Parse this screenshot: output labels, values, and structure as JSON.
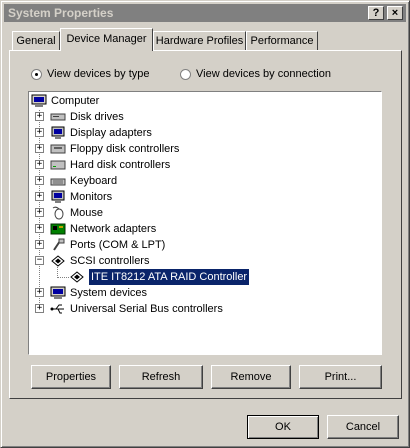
{
  "window": {
    "title": "System Properties",
    "help_label": "?",
    "close_label": "×"
  },
  "tabs": [
    {
      "label": "General"
    },
    {
      "label": "Device Manager"
    },
    {
      "label": "Hardware Profiles"
    },
    {
      "label": "Performance"
    }
  ],
  "view": {
    "by_type_label": "View devices by type",
    "by_connection_label": "View devices by connection",
    "selected": "by_type"
  },
  "tree": {
    "root": "Computer",
    "items": [
      {
        "label": "Disk drives",
        "icon": "disk-drive-icon",
        "expanded": false
      },
      {
        "label": "Display adapters",
        "icon": "monitor-icon",
        "expanded": false
      },
      {
        "label": "Floppy disk controllers",
        "icon": "floppy-controller-icon",
        "expanded": false
      },
      {
        "label": "Hard disk controllers",
        "icon": "hard-disk-controller-icon",
        "expanded": false
      },
      {
        "label": "Keyboard",
        "icon": "keyboard-icon",
        "expanded": false
      },
      {
        "label": "Monitors",
        "icon": "monitor-icon",
        "expanded": false
      },
      {
        "label": "Mouse",
        "icon": "mouse-icon",
        "expanded": false
      },
      {
        "label": "Network adapters",
        "icon": "network-adapter-icon",
        "expanded": false
      },
      {
        "label": "Ports (COM & LPT)",
        "icon": "port-icon",
        "expanded": false
      },
      {
        "label": "SCSI controllers",
        "icon": "scsi-icon",
        "expanded": true
      },
      {
        "label": "System devices",
        "icon": "computer-icon",
        "expanded": false
      },
      {
        "label": "Universal Serial Bus controllers",
        "icon": "usb-icon",
        "expanded": false
      }
    ],
    "child": {
      "label": "ITE IT8212 ATA RAID Controller",
      "icon": "scsi-icon",
      "selected": true
    }
  },
  "actions": {
    "properties_label": "Properties",
    "refresh_label": "Refresh",
    "remove_label": "Remove",
    "print_label": "Print..."
  },
  "footer": {
    "ok_label": "OK",
    "cancel_label": "Cancel"
  },
  "colors": {
    "face": "#d4d0c8",
    "titlebar": "#808080",
    "selection": "#0a246a"
  }
}
